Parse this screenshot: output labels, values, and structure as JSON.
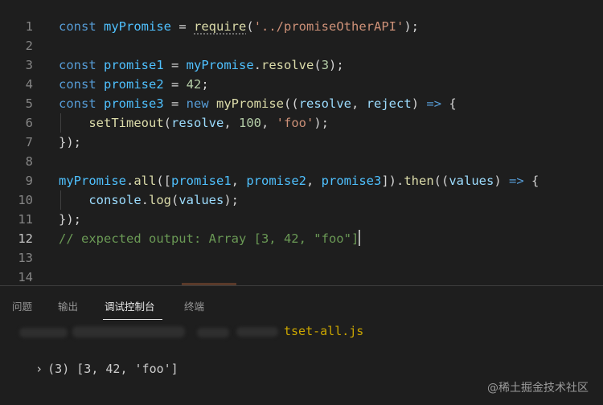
{
  "editor": {
    "line_numbers": [
      "1",
      "2",
      "3",
      "4",
      "5",
      "6",
      "7",
      "8",
      "9",
      "10",
      "11",
      "12",
      "13",
      "14"
    ],
    "active_line": "12",
    "lines": [
      {
        "num": "1",
        "tokens": [
          {
            "t": "const",
            "c": "kw"
          },
          {
            "t": " "
          },
          {
            "t": "myPromise",
            "c": "var"
          },
          {
            "t": " = "
          },
          {
            "t": "require",
            "c": "fn squig"
          },
          {
            "t": "("
          },
          {
            "t": "'../promiseOtherAPI'",
            "c": "str"
          },
          {
            "t": ");"
          }
        ]
      },
      {
        "num": "2",
        "tokens": []
      },
      {
        "num": "3",
        "tokens": [
          {
            "t": "const",
            "c": "kw"
          },
          {
            "t": " "
          },
          {
            "t": "promise1",
            "c": "var"
          },
          {
            "t": " = "
          },
          {
            "t": "myPromise",
            "c": "var"
          },
          {
            "t": "."
          },
          {
            "t": "resolve",
            "c": "fn"
          },
          {
            "t": "("
          },
          {
            "t": "3",
            "c": "num"
          },
          {
            "t": ");"
          }
        ]
      },
      {
        "num": "4",
        "tokens": [
          {
            "t": "const",
            "c": "kw"
          },
          {
            "t": " "
          },
          {
            "t": "promise2",
            "c": "var"
          },
          {
            "t": " = "
          },
          {
            "t": "42",
            "c": "num"
          },
          {
            "t": ";"
          }
        ]
      },
      {
        "num": "5",
        "tokens": [
          {
            "t": "const",
            "c": "kw"
          },
          {
            "t": " "
          },
          {
            "t": "promise3",
            "c": "var"
          },
          {
            "t": " = "
          },
          {
            "t": "new",
            "c": "kw"
          },
          {
            "t": " "
          },
          {
            "t": "myPromise",
            "c": "fn"
          },
          {
            "t": "(("
          },
          {
            "t": "resolve",
            "c": "prm"
          },
          {
            "t": ", "
          },
          {
            "t": "reject",
            "c": "prm"
          },
          {
            "t": ") "
          },
          {
            "t": "=>",
            "c": "kw"
          },
          {
            "t": " {"
          }
        ]
      },
      {
        "num": "6",
        "tokens": [
          {
            "t": "    "
          },
          {
            "t": "setTimeout",
            "c": "fn"
          },
          {
            "t": "("
          },
          {
            "t": "resolve",
            "c": "prm"
          },
          {
            "t": ", "
          },
          {
            "t": "100",
            "c": "num"
          },
          {
            "t": ", "
          },
          {
            "t": "'foo'",
            "c": "str"
          },
          {
            "t": ");"
          }
        ]
      },
      {
        "num": "7",
        "tokens": [
          {
            "t": "});"
          }
        ]
      },
      {
        "num": "8",
        "tokens": []
      },
      {
        "num": "9",
        "tokens": [
          {
            "t": "myPromise",
            "c": "var"
          },
          {
            "t": "."
          },
          {
            "t": "all",
            "c": "fn"
          },
          {
            "t": "(["
          },
          {
            "t": "promise1",
            "c": "var"
          },
          {
            "t": ", "
          },
          {
            "t": "promise2",
            "c": "var"
          },
          {
            "t": ", "
          },
          {
            "t": "promise3",
            "c": "var"
          },
          {
            "t": "])."
          },
          {
            "t": "then",
            "c": "fn"
          },
          {
            "t": "(("
          },
          {
            "t": "values",
            "c": "prm"
          },
          {
            "t": ") "
          },
          {
            "t": "=>",
            "c": "kw"
          },
          {
            "t": " {"
          }
        ]
      },
      {
        "num": "10",
        "tokens": [
          {
            "t": "    "
          },
          {
            "t": "console",
            "c": "prm"
          },
          {
            "t": "."
          },
          {
            "t": "log",
            "c": "fn"
          },
          {
            "t": "("
          },
          {
            "t": "values",
            "c": "prm"
          },
          {
            "t": ");"
          }
        ]
      },
      {
        "num": "11",
        "tokens": [
          {
            "t": "});"
          }
        ]
      },
      {
        "num": "12",
        "tokens": [
          {
            "t": "// expected output: Array [3, 42, \"foo\"]",
            "c": "cmt"
          }
        ],
        "cursor": true
      },
      {
        "num": "13",
        "tokens": []
      },
      {
        "num": "14",
        "tokens": []
      }
    ]
  },
  "panel": {
    "tabs": [
      {
        "label": "问题",
        "name": "tab-problems"
      },
      {
        "label": "输出",
        "name": "tab-output"
      },
      {
        "label": "调试控制台",
        "name": "tab-debug-console",
        "active": true
      },
      {
        "label": "终端",
        "name": "tab-terminal"
      }
    ],
    "console": {
      "source_file": "tset-all.js",
      "result_chevron": "›",
      "result_text": "(3) [3, 42, 'foo']"
    }
  },
  "watermark": "@稀土掘金技术社区",
  "colors": {
    "background": "#1e1e1e",
    "keyword": "#569cd6",
    "variable": "#4fc1ff",
    "function": "#dcdcaa",
    "string": "#ce9178",
    "number": "#b5cea8",
    "comment": "#6a9955",
    "source_link": "#cca700"
  }
}
